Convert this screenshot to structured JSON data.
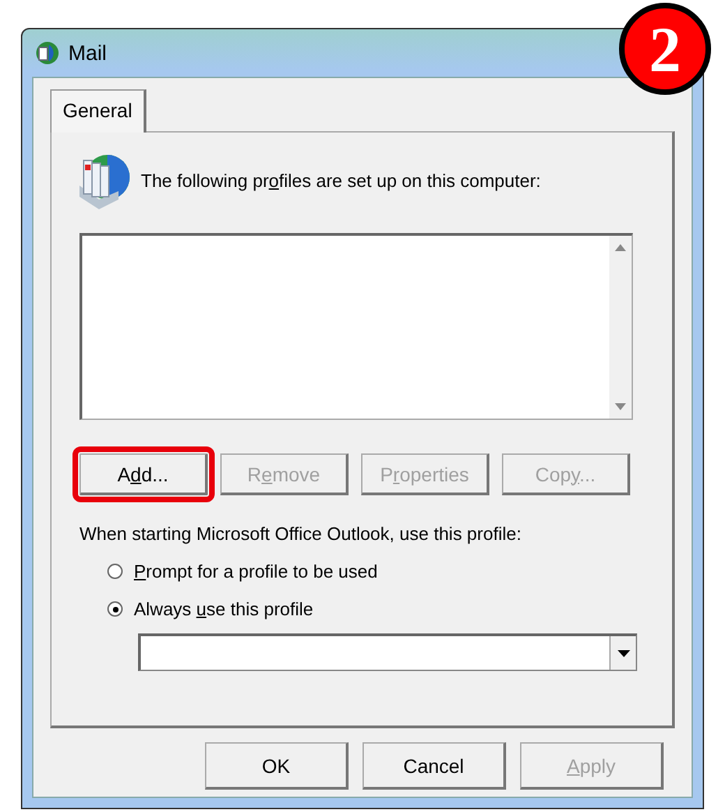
{
  "window": {
    "title": "Mail"
  },
  "step_badge": "2",
  "tabs": [
    {
      "label": "General",
      "selected": true
    }
  ],
  "intro": {
    "segments": [
      {
        "text": "The following pr",
        "underlined": false
      },
      {
        "text": "o",
        "underlined": true
      },
      {
        "text": "files are set up on this computer:",
        "underlined": false
      }
    ]
  },
  "profile_buttons": [
    {
      "segments": [
        {
          "text": "A",
          "underlined": false
        },
        {
          "text": "d",
          "underlined": true
        },
        {
          "text": "d...",
          "underlined": false
        }
      ],
      "disabled": false,
      "highlighted": true
    },
    {
      "segments": [
        {
          "text": "R",
          "underlined": false
        },
        {
          "text": "e",
          "underlined": true
        },
        {
          "text": "move",
          "underlined": false
        }
      ],
      "disabled": true,
      "highlighted": false
    },
    {
      "segments": [
        {
          "text": "P",
          "underlined": false
        },
        {
          "text": "r",
          "underlined": true
        },
        {
          "text": "operties",
          "underlined": false
        }
      ],
      "disabled": true,
      "highlighted": false
    },
    {
      "segments": [
        {
          "text": "Cop",
          "underlined": false
        },
        {
          "text": "y",
          "underlined": true
        },
        {
          "text": "...",
          "underlined": false
        }
      ],
      "disabled": true,
      "highlighted": false
    }
  ],
  "startup_label": "When starting Microsoft Office Outlook, use this profile:",
  "startup_options": [
    {
      "segments": [
        {
          "text": "P",
          "underlined": true
        },
        {
          "text": "rompt for a profile to be used",
          "underlined": false
        }
      ],
      "selected": false
    },
    {
      "segments": [
        {
          "text": "Always ",
          "underlined": false
        },
        {
          "text": "u",
          "underlined": true
        },
        {
          "text": "se this profile",
          "underlined": false
        }
      ],
      "selected": true
    }
  ],
  "dialog_buttons": [
    {
      "segments": [
        {
          "text": "OK",
          "underlined": false
        }
      ],
      "disabled": false
    },
    {
      "segments": [
        {
          "text": "Cancel",
          "underlined": false
        }
      ],
      "disabled": false
    },
    {
      "segments": [
        {
          "text": "A",
          "underlined": true
        },
        {
          "text": "pply",
          "underlined": false
        }
      ],
      "disabled": true
    }
  ]
}
